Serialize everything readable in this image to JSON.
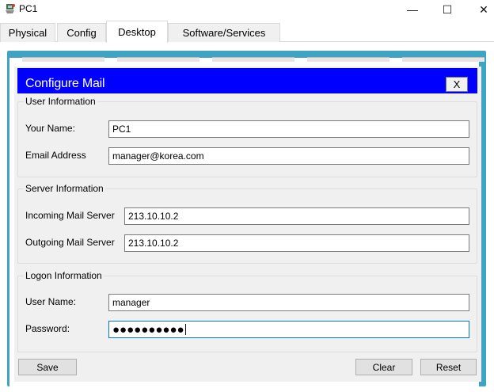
{
  "window": {
    "title": "PC1",
    "icon": "pc-app-icon",
    "controls": {
      "minimize": "—",
      "maximize": "☐",
      "close": "✕"
    }
  },
  "tabs": [
    {
      "label": "Physical",
      "active": false
    },
    {
      "label": "Config",
      "active": false
    },
    {
      "label": "Desktop",
      "active": true
    },
    {
      "label": "Software/Services",
      "active": false
    }
  ],
  "panel": {
    "title": "Configure Mail",
    "close_label": "X",
    "header_color": "#0000ff"
  },
  "user_info": {
    "heading": "User Information",
    "name_label": "Your Name:",
    "name_value": "PC1",
    "email_label": "Email Address",
    "email_value": "manager@korea.com"
  },
  "server_info": {
    "heading": "Server Information",
    "incoming_label": "Incoming Mail Server",
    "incoming_value": "213.10.10.2",
    "outgoing_label": "Outgoing Mail Server",
    "outgoing_value": "213.10.10.2"
  },
  "logon_info": {
    "heading": "Logon Information",
    "user_label": "User Name:",
    "user_value": "manager",
    "password_label": "Password:",
    "password_value": "●●●●●●●●●●"
  },
  "buttons": {
    "save": "Save",
    "clear": "Clear",
    "reset": "Reset"
  }
}
